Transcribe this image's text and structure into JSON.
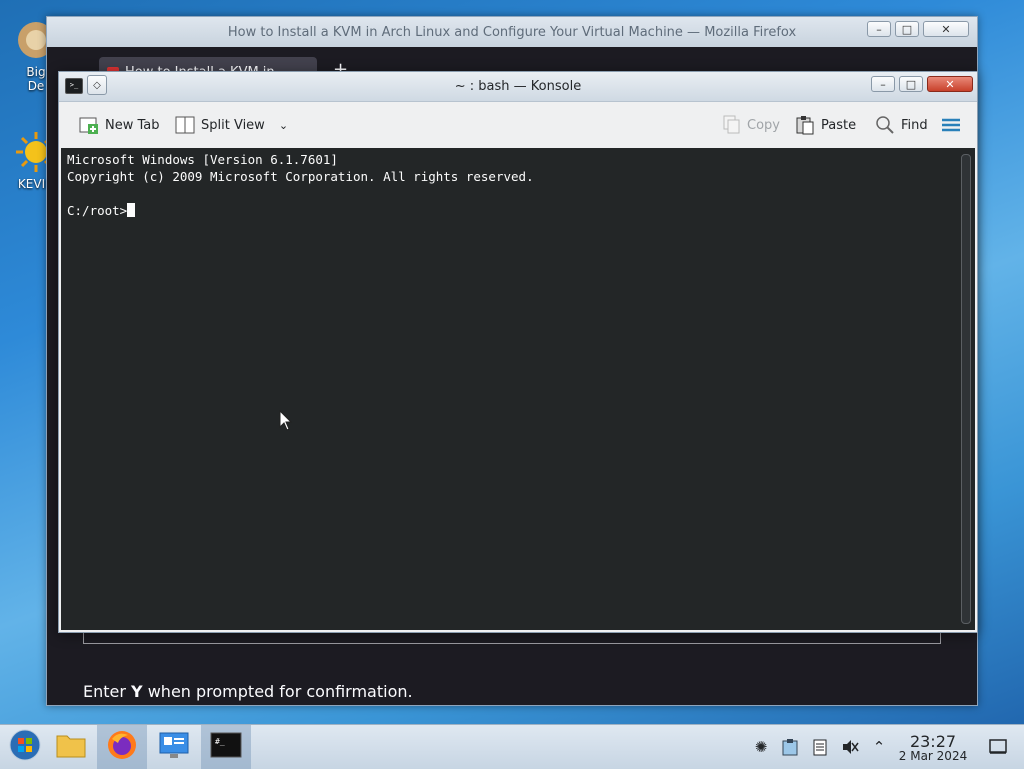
{
  "desktop": {
    "icons": [
      {
        "label": "Big\nDe",
        "icon": "package-icon"
      },
      {
        "label": "KEVIN",
        "icon": "sun-icon"
      }
    ]
  },
  "firefox": {
    "title": "How to Install a KVM in Arch Linux and Configure Your Virtual Machine — Mozilla Firefox",
    "tab_title": "How to Install a KVM in",
    "new_tab_symbol": "+",
    "paragraph_prefix": "Enter ",
    "paragraph_bold": "Y",
    "paragraph_suffix": " when prompted for confirmation."
  },
  "konsole": {
    "title": "~ : bash — Konsole",
    "toolbar": {
      "new_tab": "New Tab",
      "split_view": "Split View",
      "copy": "Copy",
      "paste": "Paste",
      "find": "Find"
    },
    "terminal": {
      "line1": "Microsoft Windows [Version 6.1.7601]",
      "line2": "Copyright (c) 2009 Microsoft Corporation. All rights reserved.",
      "line3": "",
      "prompt": "C:/root>"
    }
  },
  "taskbar": {
    "apps": [
      "start-menu",
      "file-manager",
      "firefox",
      "system-settings",
      "konsole"
    ],
    "active_app": "konsole",
    "tray": [
      "network-icon",
      "clipboard-icon",
      "notes-icon",
      "volume-muted-icon",
      "chevron-up-icon"
    ],
    "clock_time": "23:27",
    "clock_date": "2 Mar 2024"
  },
  "colors": {
    "terminal_bg": "#232627",
    "terminal_fg": "#fcfcfc",
    "accent": "#3daee9"
  }
}
